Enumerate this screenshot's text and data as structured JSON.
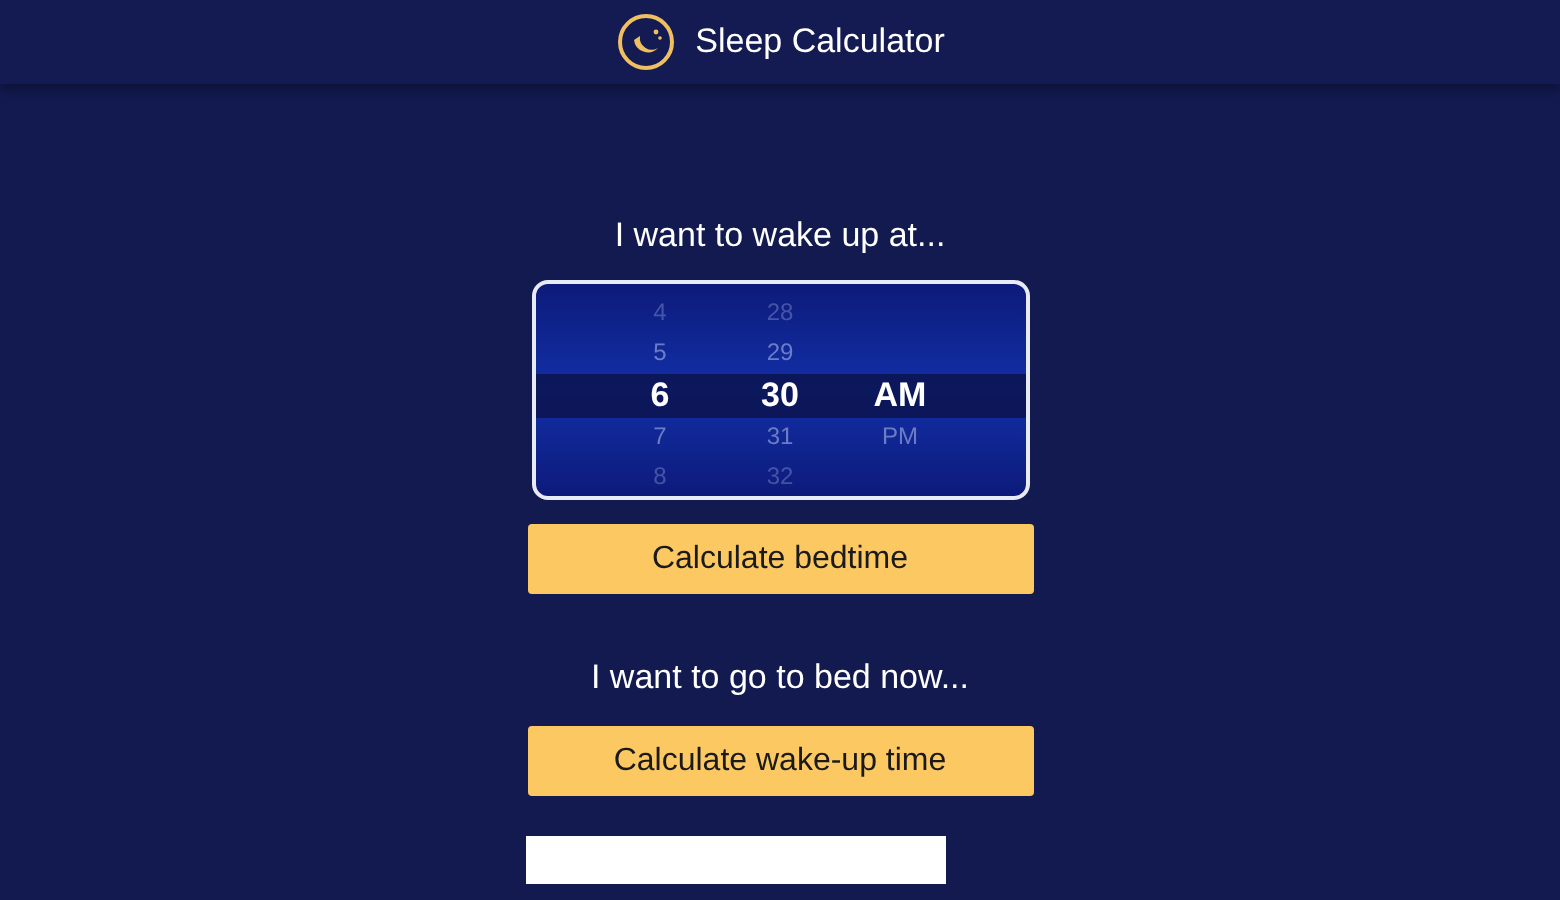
{
  "header": {
    "title": "Sleep Calculator"
  },
  "wake": {
    "prompt": "I want to wake up at...",
    "columns": [
      {
        "items": [
          {
            "label": "4",
            "selected": false
          },
          {
            "label": "5",
            "selected": false
          },
          {
            "label": "6",
            "selected": true
          },
          {
            "label": "7",
            "selected": false
          },
          {
            "label": "8",
            "selected": false
          }
        ]
      },
      {
        "items": [
          {
            "label": "28",
            "selected": false
          },
          {
            "label": "29",
            "selected": false
          },
          {
            "label": "30",
            "selected": true
          },
          {
            "label": "31",
            "selected": false
          },
          {
            "label": "32",
            "selected": false
          }
        ]
      },
      {
        "items": [
          {
            "label": "AM",
            "selected": true
          },
          {
            "label": "PM",
            "selected": false
          }
        ]
      }
    ],
    "button": "Calculate bedtime"
  },
  "bed": {
    "prompt": "I want to go to bed now...",
    "button": "Calculate wake-up time"
  }
}
